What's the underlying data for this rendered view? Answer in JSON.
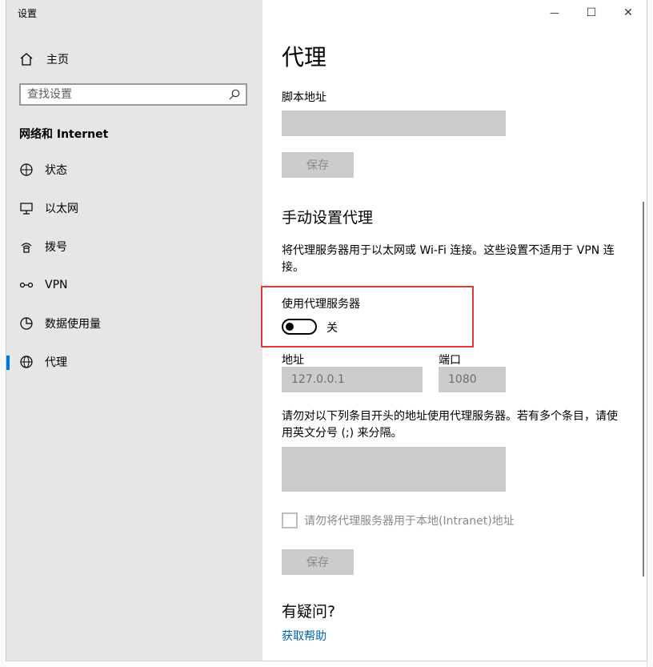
{
  "window": {
    "title": "设置",
    "controls": {
      "minimize": "—",
      "maximize": "☐",
      "close": "✕"
    }
  },
  "sidebar": {
    "home_label": "主页",
    "search_placeholder": "查找设置",
    "category": "网络和 Internet",
    "items": [
      {
        "label": "状态",
        "icon": "status-icon"
      },
      {
        "label": "以太网",
        "icon": "ethernet-icon"
      },
      {
        "label": "拨号",
        "icon": "dialup-icon"
      },
      {
        "label": "VPN",
        "icon": "vpn-icon"
      },
      {
        "label": "数据使用量",
        "icon": "data-usage-icon"
      },
      {
        "label": "代理",
        "icon": "globe-icon",
        "active": true
      }
    ]
  },
  "main": {
    "title": "代理",
    "script": {
      "label": "脚本地址",
      "value": "",
      "save_label": "保存"
    },
    "manual": {
      "heading": "手动设置代理",
      "description": "将代理服务器用于以太网或 Wi-Fi 连接。这些设置不适用于 VPN 连接。",
      "use_proxy_label": "使用代理服务器",
      "toggle_state": "关",
      "toggle_on": false,
      "address_label": "地址",
      "address_value": "127.0.0.1",
      "port_label": "端口",
      "port_value": "1080",
      "exceptions_description": "请勿对以下列条目开头的地址使用代理服务器。若有多个条目，请使用英文分号 (;) 来分隔。",
      "exceptions_value": "",
      "bypass_local_label": "请勿将代理服务器用于本地(Intranet)地址",
      "bypass_local_checked": false,
      "save_label": "保存"
    },
    "help": {
      "heading": "有疑问?",
      "link": "获取帮助"
    }
  },
  "colors": {
    "accent": "#0078d7",
    "highlight_box": "#e53935",
    "link": "#0063b1",
    "sidebar_bg": "#e6e6e6"
  }
}
